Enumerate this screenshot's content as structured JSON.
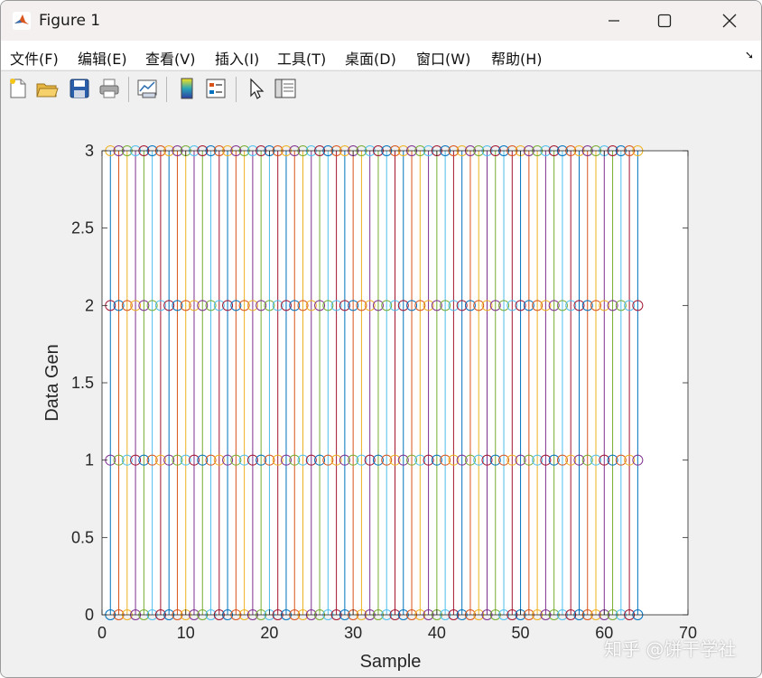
{
  "window": {
    "title": "Figure 1",
    "controls": [
      "minimize",
      "maximize",
      "close"
    ]
  },
  "menu": {
    "items": [
      "文件(F)",
      "编辑(E)",
      "查看(V)",
      "插入(I)",
      "工具(T)",
      "桌面(D)",
      "窗口(W)",
      "帮助(H)"
    ]
  },
  "toolbar": {
    "icons": [
      "new-figure-icon",
      "open-file-icon",
      "save-icon",
      "print-icon",
      "link-plot-icon",
      "insert-colorbar-icon",
      "insert-legend-icon",
      "select-arrow-icon",
      "property-editor-icon"
    ]
  },
  "colors": {
    "series": [
      "#0072BD",
      "#D95319",
      "#EDB120",
      "#7E2F8E",
      "#77AC30",
      "#4DBEEE",
      "#A2142F"
    ]
  },
  "watermark": "知乎 @饼干学社",
  "chart_data": {
    "type": "stem",
    "marker": "open-circle",
    "xlabel": "Sample",
    "ylabel": "Data Gen",
    "xlim": [
      0,
      70
    ],
    "ylim": [
      0,
      3
    ],
    "xticks": [
      0,
      10,
      20,
      30,
      40,
      50,
      60,
      70
    ],
    "yticks": [
      0,
      0.5,
      1,
      1.5,
      2,
      2.5,
      3
    ],
    "x": [
      1,
      2,
      3,
      4,
      5,
      6,
      7,
      8,
      9,
      10,
      11,
      12,
      13,
      14,
      15,
      16,
      17,
      18,
      19,
      20,
      21,
      22,
      23,
      24,
      25,
      26,
      27,
      28,
      29,
      30,
      31,
      32,
      33,
      34,
      35,
      36,
      37,
      38,
      39,
      40,
      41,
      42,
      43,
      44,
      45,
      46,
      47,
      48,
      49,
      50,
      51,
      52,
      53,
      54,
      55,
      56,
      57,
      58,
      59,
      60,
      61,
      62,
      63,
      64
    ],
    "series_columns": 64,
    "series_values_note": "each sample's stem appears at levels 0,1,2,3",
    "levels": [
      0,
      1,
      2,
      3
    ]
  }
}
